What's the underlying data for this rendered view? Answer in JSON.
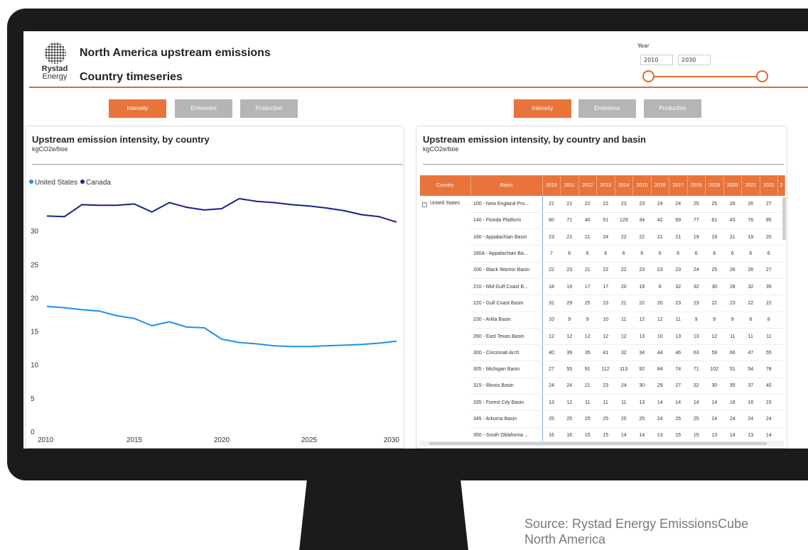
{
  "header": {
    "title": "North America upstream emissions",
    "subtitle": "Country timeseries",
    "logo_text_1": "Rystad",
    "logo_text_2": "Energy"
  },
  "year_filter": {
    "label": "Year",
    "start": "2010",
    "end": "2030",
    "range_start_fraction": 0,
    "range_end_fraction": 1
  },
  "left_buttons": [
    "Intensity",
    "Emissions",
    "Production"
  ],
  "right_buttons": [
    "Intensity",
    "Emissions",
    "Production"
  ],
  "left_panel": {
    "title": "Upstream emission intensity, by country",
    "unit": "kgCO2e/boe",
    "legend": [
      {
        "name": "United States",
        "color": "#1f8ff0"
      },
      {
        "name": "Canada",
        "color": "#18208c"
      }
    ]
  },
  "chart_data": {
    "type": "line",
    "title": "Upstream emission intensity, by country",
    "ylabel": "kgCO2e/boe",
    "xlabel": "",
    "xlim": [
      2010,
      2030
    ],
    "ylim": [
      0,
      35
    ],
    "x_ticks": [
      2010,
      2015,
      2020,
      2025,
      2030
    ],
    "y_ticks": [
      0,
      5,
      10,
      15,
      20,
      25,
      30
    ],
    "grid": false,
    "legend_position": "top-left",
    "x": [
      2010,
      2011,
      2012,
      2013,
      2014,
      2015,
      2016,
      2017,
      2018,
      2019,
      2020,
      2021,
      2022,
      2023,
      2024,
      2025,
      2026,
      2027,
      2028,
      2029,
      2030
    ],
    "series": [
      {
        "name": "United States",
        "color": "#1f8ff0",
        "values": [
          18.7,
          18.5,
          18.2,
          18.0,
          17.3,
          16.9,
          15.8,
          16.4,
          15.6,
          15.5,
          13.8,
          13.3,
          13.1,
          12.8,
          12.7,
          12.7,
          12.8,
          12.9,
          13.0,
          13.2,
          13.5
        ]
      },
      {
        "name": "Canada",
        "color": "#18208c",
        "values": [
          32.2,
          32.1,
          33.9,
          33.8,
          33.8,
          34.0,
          32.8,
          34.2,
          33.5,
          33.1,
          33.3,
          34.8,
          34.4,
          34.2,
          33.9,
          33.7,
          33.4,
          33.0,
          32.4,
          32.1,
          31.3
        ]
      }
    ]
  },
  "right_panel": {
    "title": "Upstream emission intensity, by country and basin",
    "unit": "kgCO2e/boe",
    "table": {
      "headers": [
        "Country",
        "Basin",
        "2010",
        "2011",
        "2012",
        "2013",
        "2014",
        "2015",
        "2016",
        "2017",
        "2018",
        "2019",
        "2020",
        "2021",
        "2022",
        "2"
      ],
      "country": "United States",
      "expander": "−",
      "rows": [
        {
          "basin": "100 - New England Pro...",
          "values": [
            "21",
            "21",
            "22",
            "22",
            "23",
            "23",
            "24",
            "24",
            "25",
            "25",
            "26",
            "26",
            "27",
            ""
          ]
        },
        {
          "basin": "140 - Florida Platform",
          "values": [
            "60",
            "71",
            "40",
            "51",
            "129",
            "34",
            "42",
            "69",
            "77",
            "61",
            "43",
            "76",
            "85",
            ""
          ]
        },
        {
          "basin": "160 - Appalachian Basin",
          "values": [
            "23",
            "21",
            "21",
            "24",
            "22",
            "22",
            "21",
            "21",
            "19",
            "19",
            "21",
            "19",
            "20",
            ""
          ]
        },
        {
          "basin": "160A - Appalachian Ba...",
          "values": [
            "7",
            "6",
            "6",
            "6",
            "6",
            "6",
            "6",
            "6",
            "6",
            "6",
            "6",
            "6",
            "6",
            ""
          ]
        },
        {
          "basin": "200 - Black Warrior Basin",
          "values": [
            "22",
            "23",
            "21",
            "22",
            "22",
            "23",
            "23",
            "23",
            "24",
            "25",
            "26",
            "26",
            "27",
            ""
          ]
        },
        {
          "basin": "210 - Mid-Gulf Coast B...",
          "values": [
            "18",
            "19",
            "17",
            "17",
            "20",
            "19",
            "6",
            "32",
            "32",
            "30",
            "28",
            "32",
            "35",
            ""
          ]
        },
        {
          "basin": "220 - Gulf Coast Basin",
          "values": [
            "31",
            "29",
            "25",
            "23",
            "21",
            "22",
            "20",
            "23",
            "23",
            "22",
            "23",
            "22",
            "22",
            ""
          ]
        },
        {
          "basin": "230 - Arkla Basin",
          "values": [
            "10",
            "9",
            "9",
            "10",
            "11",
            "12",
            "12",
            "11",
            "9",
            "9",
            "8",
            "8",
            "8",
            ""
          ]
        },
        {
          "basin": "260 - East Texas Basin",
          "values": [
            "12",
            "12",
            "12",
            "12",
            "12",
            "13",
            "10",
            "13",
            "13",
            "12",
            "11",
            "11",
            "11",
            ""
          ]
        },
        {
          "basin": "300 - Cincinnati Arch",
          "values": [
            "40",
            "39",
            "35",
            "41",
            "32",
            "34",
            "44",
            "46",
            "63",
            "59",
            "66",
            "47",
            "55",
            ""
          ]
        },
        {
          "basin": "305 - Michigan Basin",
          "values": [
            "27",
            "55",
            "91",
            "112",
            "113",
            "92",
            "84",
            "74",
            "71",
            "102",
            "51",
            "54",
            "78",
            ""
          ]
        },
        {
          "basin": "315 - Illinois Basin",
          "values": [
            "24",
            "24",
            "21",
            "23",
            "24",
            "30",
            "29",
            "27",
            "32",
            "30",
            "35",
            "37",
            "40",
            ""
          ]
        },
        {
          "basin": "335 - Forest City Basin",
          "values": [
            "13",
            "12",
            "11",
            "11",
            "11",
            "13",
            "14",
            "14",
            "14",
            "14",
            "16",
            "16",
            "15",
            ""
          ]
        },
        {
          "basin": "345 - Arkoma Basin",
          "values": [
            "25",
            "25",
            "25",
            "25",
            "25",
            "25",
            "24",
            "25",
            "25",
            "24",
            "24",
            "24",
            "24",
            ""
          ]
        },
        {
          "basin": "350 - South Oklahoma ...",
          "values": [
            "16",
            "16",
            "15",
            "15",
            "14",
            "14",
            "13",
            "15",
            "15",
            "13",
            "14",
            "13",
            "14",
            ""
          ]
        }
      ]
    }
  },
  "source_note": {
    "line1": "Source: Rystad Energy EmissionsCube",
    "line2": "North America"
  }
}
